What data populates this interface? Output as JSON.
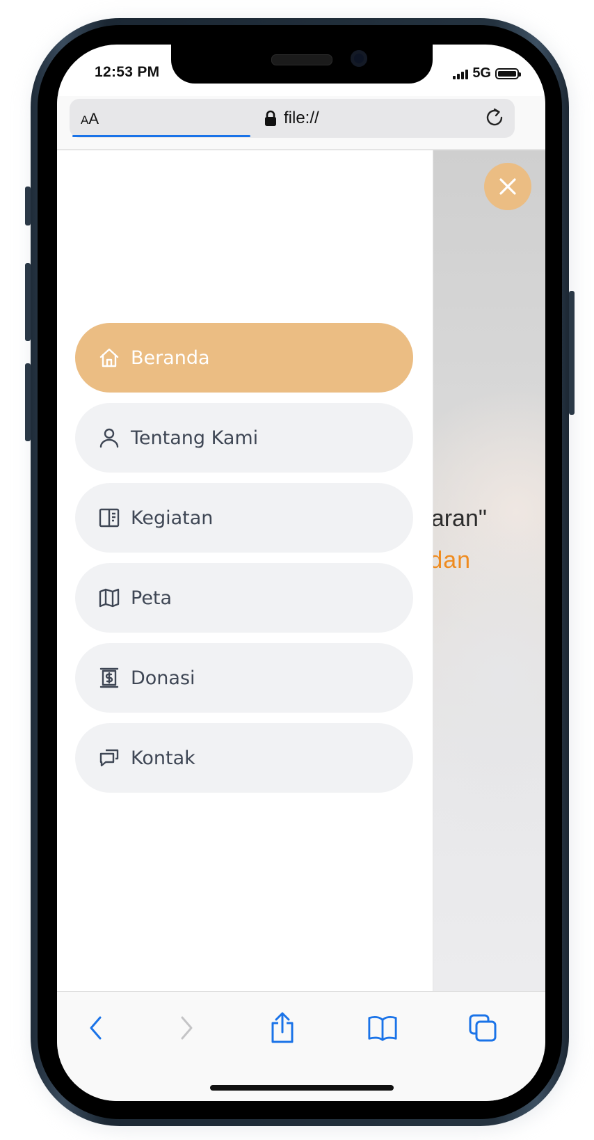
{
  "status_bar": {
    "time": "12:53 PM",
    "network": "5G"
  },
  "browser": {
    "text_size_label_small": "A",
    "text_size_label_large": "A",
    "url": "file://",
    "load_progress": 0.4
  },
  "page_background": {
    "line1": "aharan\"",
    "line2": "n dan",
    "accent": "#ef8b1f"
  },
  "nav": {
    "accent": "#ebbd83",
    "items": [
      {
        "label": "Beranda",
        "icon": "home-icon",
        "active": true
      },
      {
        "label": "Tentang Kami",
        "icon": "user-icon",
        "active": false
      },
      {
        "label": "Kegiatan",
        "icon": "book-layout-icon",
        "active": false
      },
      {
        "label": "Peta",
        "icon": "map-icon",
        "active": false
      },
      {
        "label": "Donasi",
        "icon": "receipt-dollar-icon",
        "active": false
      },
      {
        "label": "Kontak",
        "icon": "chat-icon",
        "active": false
      }
    ]
  },
  "toolbar": {
    "back_icon": "chevron-left-icon",
    "forward_icon": "chevron-right-icon",
    "share_icon": "share-icon",
    "bookmarks_icon": "book-icon",
    "tabs_icon": "tabs-icon",
    "tint": "#1a73e8"
  }
}
